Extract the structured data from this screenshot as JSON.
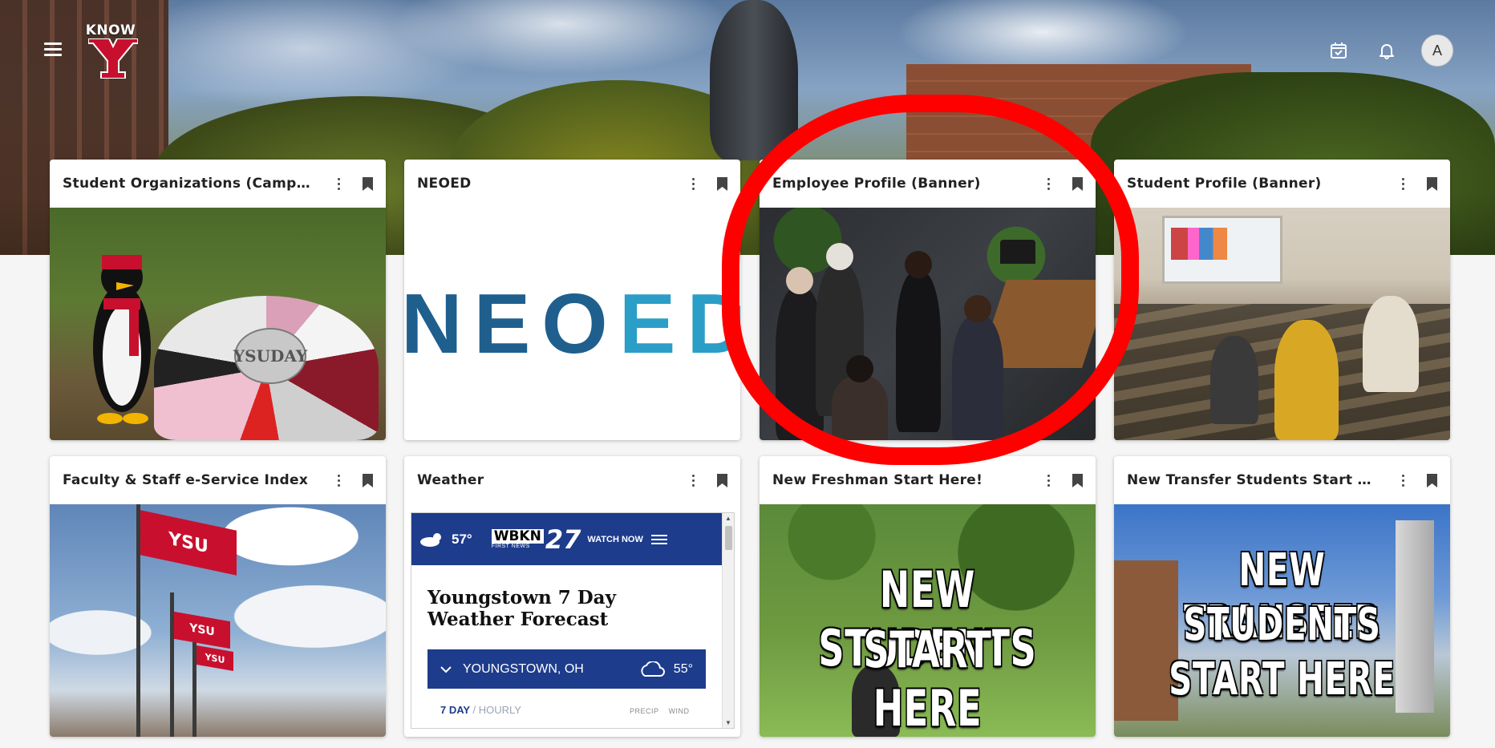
{
  "header": {
    "logo_text": "KNOW",
    "avatar_initial": "A",
    "icons": [
      "menu-icon",
      "calendar-check-icon",
      "bell-icon"
    ]
  },
  "colors": {
    "ysu_red": "#c8102e",
    "neoed_dark": "#1f5f8e",
    "neoed_light": "#2a9ec6",
    "weather_blue": "#1e3c8c",
    "annotation_red": "#ff0000"
  },
  "cards": [
    {
      "title": "Student Organizations (Campus Groups)"
    },
    {
      "title": "NEOED",
      "image_text_a": "NEO",
      "image_text_b": "ED"
    },
    {
      "title": "Employee Profile (Banner)"
    },
    {
      "title": "Student Profile (Banner)"
    },
    {
      "title": "Faculty & Staff e-Service Index"
    },
    {
      "title": "Weather"
    },
    {
      "title": "New Freshman Start Here!",
      "image_line1": "NEW STUDENTS",
      "image_line2": "START HERE"
    },
    {
      "title": "New Transfer Students Start Here!",
      "image_line1": "NEW TRANSFER",
      "image_line2": "STUDENTS",
      "image_line3": "START HERE"
    }
  ],
  "rock": {
    "line1": "YSU",
    "line2": "DAY"
  },
  "flags": {
    "flag1": "YSU",
    "flag2": "YSU",
    "flag3": "YSU"
  },
  "weather": {
    "current_temp": "57°",
    "station_logo": "WBKN",
    "station_number": "27",
    "station_sub": "FIRST NEWS",
    "watch_now": "WATCH NOW",
    "title": "Youngstown 7 Day Weather Forecast",
    "location": "YOUNGSTOWN, OH",
    "location_temp": "55°",
    "tab_active": "7 DAY",
    "tab_inactive": "HOURLY",
    "col_precip": "PRECIP",
    "col_wind": "WIND"
  }
}
